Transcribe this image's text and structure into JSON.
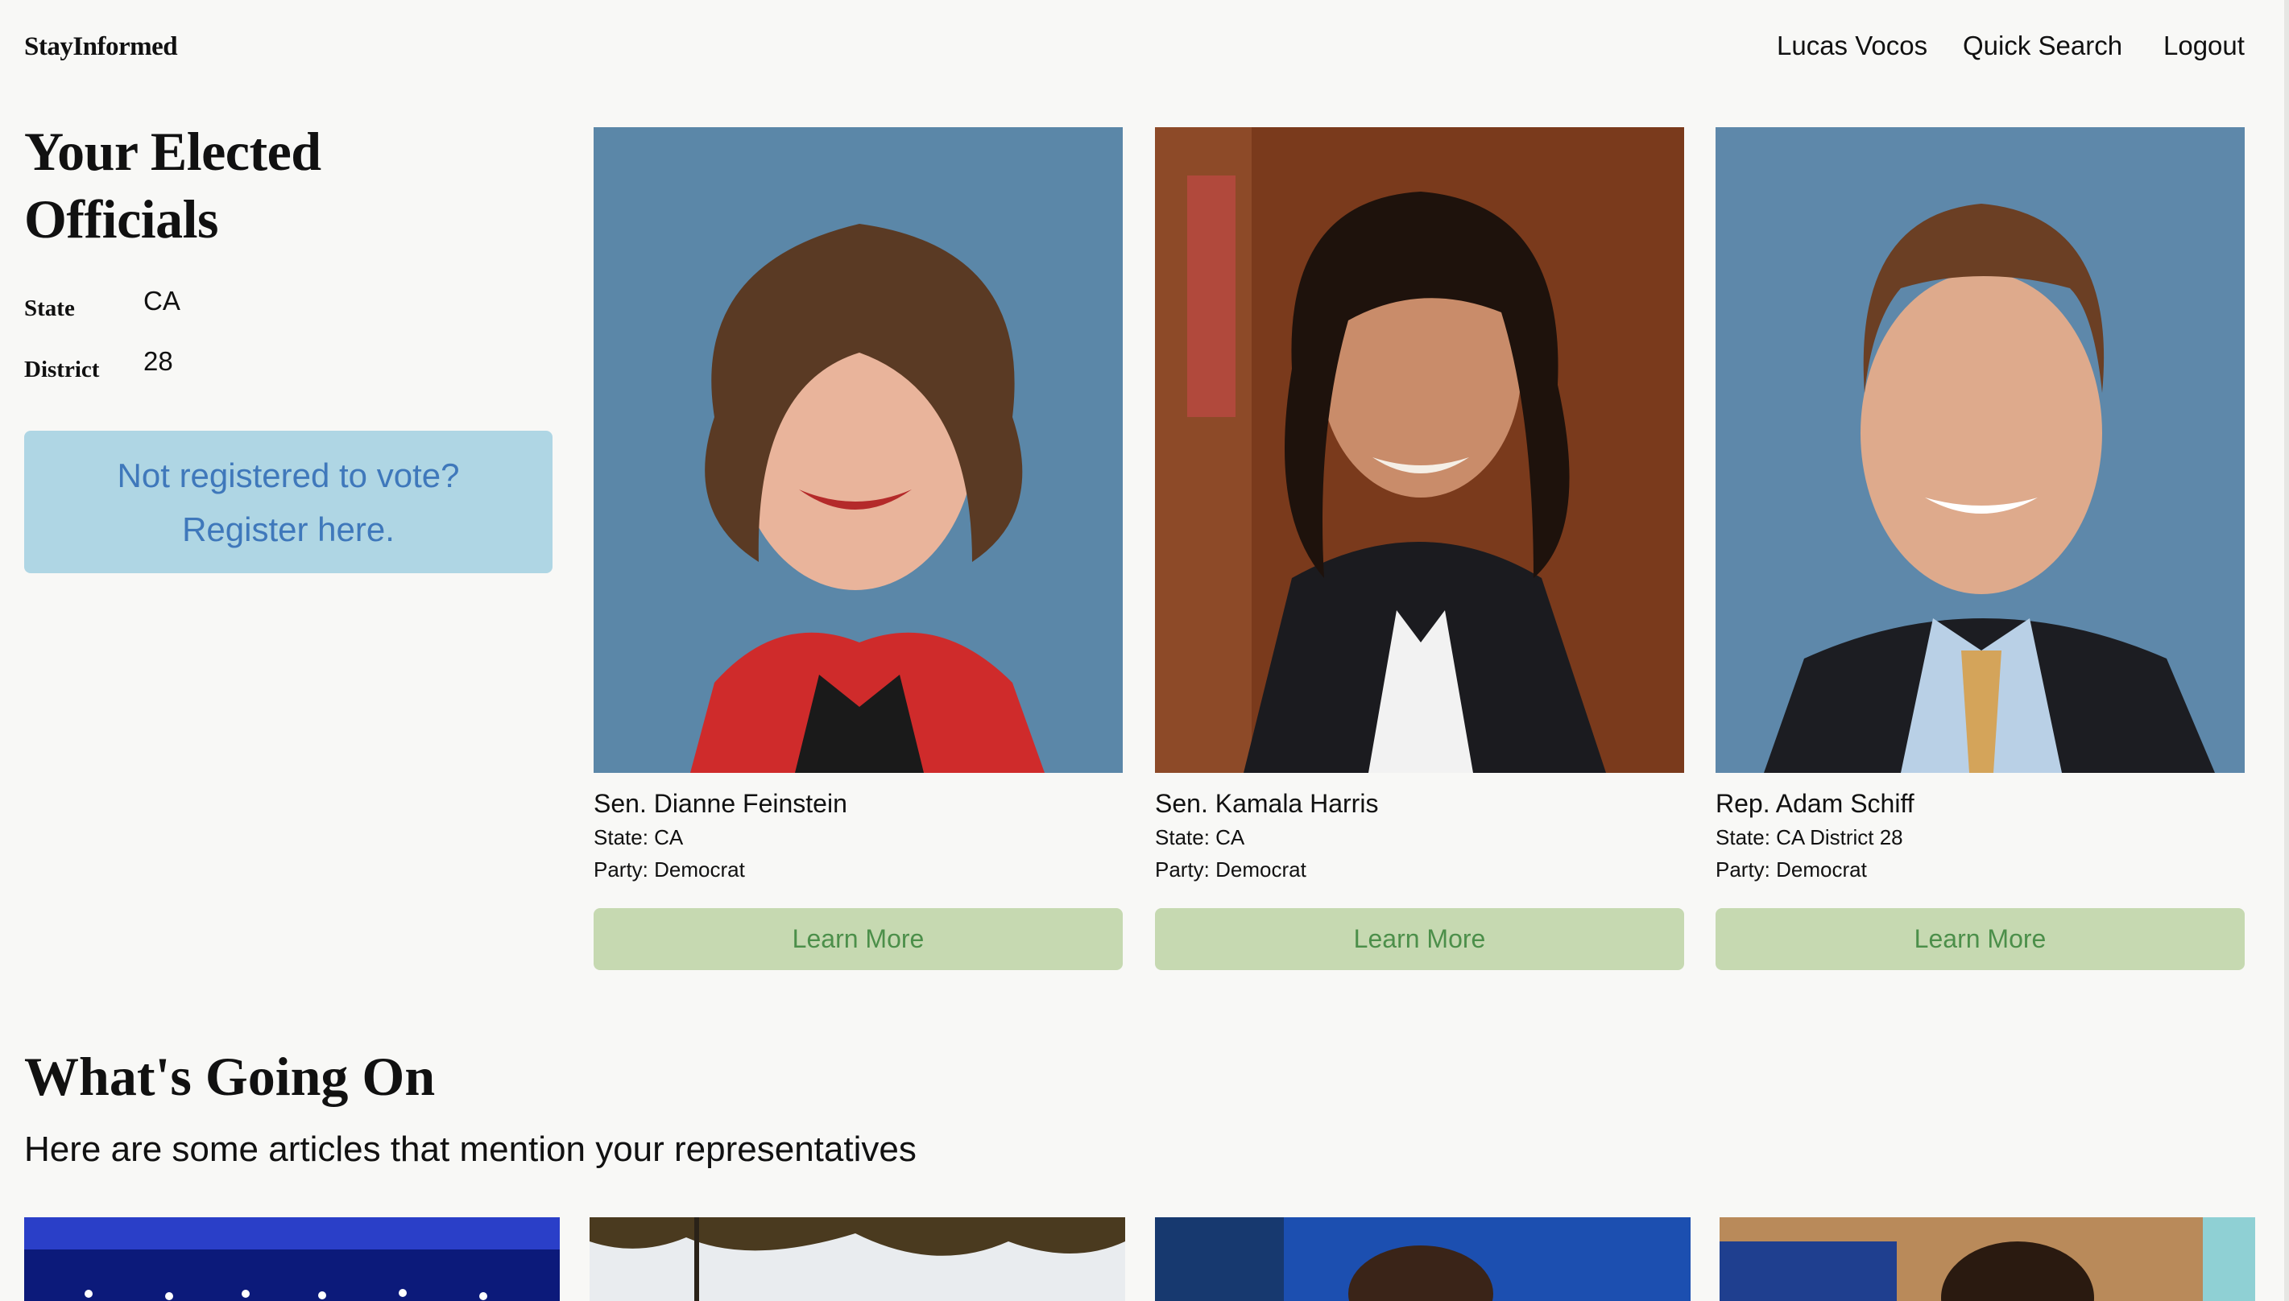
{
  "header": {
    "logo": "StayInformed",
    "nav": [
      "Lucas Vocos",
      "Quick Search",
      "Logout"
    ]
  },
  "sidebar": {
    "title": "Your Elected Officials",
    "state_label": "State",
    "state_value": "CA",
    "district_label": "District",
    "district_value": "28",
    "register_cta": "Not registered to vote? Register here."
  },
  "officials": [
    {
      "name": "Sen. Dianne Feinstein",
      "state": "State: CA",
      "party": "Party: Democrat",
      "button": "Learn More"
    },
    {
      "name": "Sen. Kamala Harris",
      "state": "State: CA",
      "party": "Party: Democrat",
      "button": "Learn More"
    },
    {
      "name": "Rep. Adam Schiff",
      "state": "State: CA District 28",
      "party": "Party: Democrat",
      "button": "Learn More"
    }
  ],
  "news": {
    "title": "What's Going On",
    "subtitle": "Here are some articles that mention your representatives"
  },
  "colors": {
    "background": "#f8f8f6",
    "register_bg": "#afd6e4",
    "register_text": "#3f78bb",
    "button_bg": "#c6d9b1",
    "button_text": "#4c8f4a"
  }
}
